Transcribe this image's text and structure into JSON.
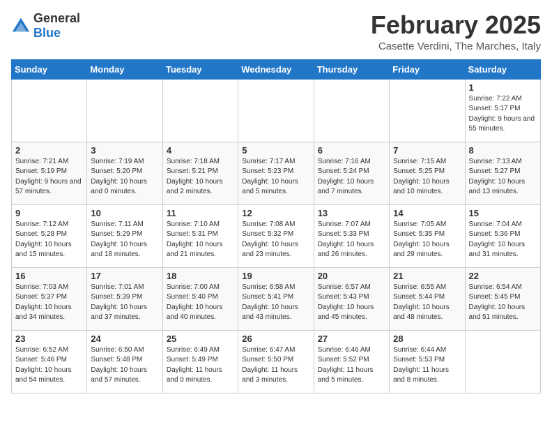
{
  "logo": {
    "general": "General",
    "blue": "Blue"
  },
  "header": {
    "month": "February 2025",
    "location": "Casette Verdini, The Marches, Italy"
  },
  "weekdays": [
    "Sunday",
    "Monday",
    "Tuesday",
    "Wednesday",
    "Thursday",
    "Friday",
    "Saturday"
  ],
  "weeks": [
    [
      {
        "day": "",
        "info": ""
      },
      {
        "day": "",
        "info": ""
      },
      {
        "day": "",
        "info": ""
      },
      {
        "day": "",
        "info": ""
      },
      {
        "day": "",
        "info": ""
      },
      {
        "day": "",
        "info": ""
      },
      {
        "day": "1",
        "info": "Sunrise: 7:22 AM\nSunset: 5:17 PM\nDaylight: 9 hours and 55 minutes."
      }
    ],
    [
      {
        "day": "2",
        "info": "Sunrise: 7:21 AM\nSunset: 5:19 PM\nDaylight: 9 hours and 57 minutes."
      },
      {
        "day": "3",
        "info": "Sunrise: 7:19 AM\nSunset: 5:20 PM\nDaylight: 10 hours and 0 minutes."
      },
      {
        "day": "4",
        "info": "Sunrise: 7:18 AM\nSunset: 5:21 PM\nDaylight: 10 hours and 2 minutes."
      },
      {
        "day": "5",
        "info": "Sunrise: 7:17 AM\nSunset: 5:23 PM\nDaylight: 10 hours and 5 minutes."
      },
      {
        "day": "6",
        "info": "Sunrise: 7:16 AM\nSunset: 5:24 PM\nDaylight: 10 hours and 7 minutes."
      },
      {
        "day": "7",
        "info": "Sunrise: 7:15 AM\nSunset: 5:25 PM\nDaylight: 10 hours and 10 minutes."
      },
      {
        "day": "8",
        "info": "Sunrise: 7:13 AM\nSunset: 5:27 PM\nDaylight: 10 hours and 13 minutes."
      }
    ],
    [
      {
        "day": "9",
        "info": "Sunrise: 7:12 AM\nSunset: 5:28 PM\nDaylight: 10 hours and 15 minutes."
      },
      {
        "day": "10",
        "info": "Sunrise: 7:11 AM\nSunset: 5:29 PM\nDaylight: 10 hours and 18 minutes."
      },
      {
        "day": "11",
        "info": "Sunrise: 7:10 AM\nSunset: 5:31 PM\nDaylight: 10 hours and 21 minutes."
      },
      {
        "day": "12",
        "info": "Sunrise: 7:08 AM\nSunset: 5:32 PM\nDaylight: 10 hours and 23 minutes."
      },
      {
        "day": "13",
        "info": "Sunrise: 7:07 AM\nSunset: 5:33 PM\nDaylight: 10 hours and 26 minutes."
      },
      {
        "day": "14",
        "info": "Sunrise: 7:05 AM\nSunset: 5:35 PM\nDaylight: 10 hours and 29 minutes."
      },
      {
        "day": "15",
        "info": "Sunrise: 7:04 AM\nSunset: 5:36 PM\nDaylight: 10 hours and 31 minutes."
      }
    ],
    [
      {
        "day": "16",
        "info": "Sunrise: 7:03 AM\nSunset: 5:37 PM\nDaylight: 10 hours and 34 minutes."
      },
      {
        "day": "17",
        "info": "Sunrise: 7:01 AM\nSunset: 5:39 PM\nDaylight: 10 hours and 37 minutes."
      },
      {
        "day": "18",
        "info": "Sunrise: 7:00 AM\nSunset: 5:40 PM\nDaylight: 10 hours and 40 minutes."
      },
      {
        "day": "19",
        "info": "Sunrise: 6:58 AM\nSunset: 5:41 PM\nDaylight: 10 hours and 43 minutes."
      },
      {
        "day": "20",
        "info": "Sunrise: 6:57 AM\nSunset: 5:43 PM\nDaylight: 10 hours and 45 minutes."
      },
      {
        "day": "21",
        "info": "Sunrise: 6:55 AM\nSunset: 5:44 PM\nDaylight: 10 hours and 48 minutes."
      },
      {
        "day": "22",
        "info": "Sunrise: 6:54 AM\nSunset: 5:45 PM\nDaylight: 10 hours and 51 minutes."
      }
    ],
    [
      {
        "day": "23",
        "info": "Sunrise: 6:52 AM\nSunset: 5:46 PM\nDaylight: 10 hours and 54 minutes."
      },
      {
        "day": "24",
        "info": "Sunrise: 6:50 AM\nSunset: 5:48 PM\nDaylight: 10 hours and 57 minutes."
      },
      {
        "day": "25",
        "info": "Sunrise: 6:49 AM\nSunset: 5:49 PM\nDaylight: 11 hours and 0 minutes."
      },
      {
        "day": "26",
        "info": "Sunrise: 6:47 AM\nSunset: 5:50 PM\nDaylight: 11 hours and 3 minutes."
      },
      {
        "day": "27",
        "info": "Sunrise: 6:46 AM\nSunset: 5:52 PM\nDaylight: 11 hours and 5 minutes."
      },
      {
        "day": "28",
        "info": "Sunrise: 6:44 AM\nSunset: 5:53 PM\nDaylight: 11 hours and 8 minutes."
      },
      {
        "day": "",
        "info": ""
      }
    ]
  ]
}
